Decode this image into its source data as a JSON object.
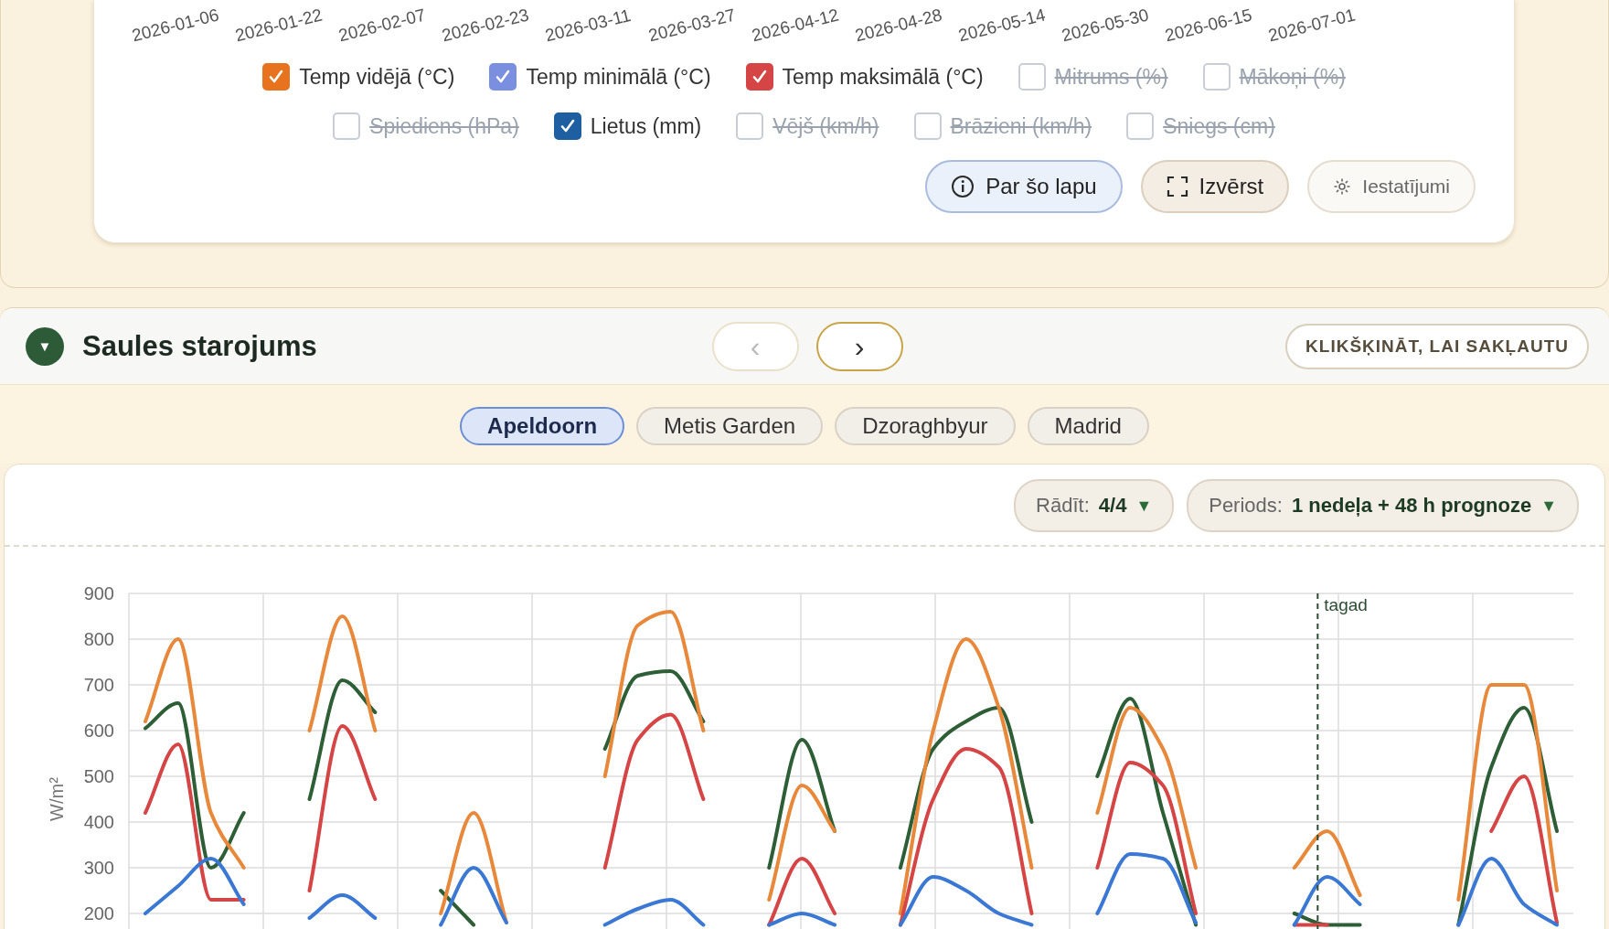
{
  "top_chart": {
    "x_labels": [
      "2026-01-06",
      "2026-01-22",
      "2026-02-07",
      "2026-02-23",
      "2026-03-11",
      "2026-03-27",
      "2026-04-12",
      "2026-04-28",
      "2026-05-14",
      "2026-05-30",
      "2026-06-15",
      "2026-07-01"
    ]
  },
  "legend": [
    {
      "items": [
        {
          "label": "Temp vidējā (°C)",
          "checked": true,
          "color": "#e8731f"
        },
        {
          "label": "Temp minimālā (°C)",
          "checked": true,
          "color": "#7b8fe0"
        },
        {
          "label": "Temp maksimālā (°C)",
          "checked": true,
          "color": "#d64545"
        },
        {
          "label": "Mitrums (%)",
          "checked": false
        },
        {
          "label": "Mākoņi (%)",
          "checked": false
        }
      ]
    },
    {
      "items": [
        {
          "label": "Spiediens (hPa)",
          "checked": false
        },
        {
          "label": "Lietus (mm)",
          "checked": true,
          "color": "#1d5fa0"
        },
        {
          "label": "Vējš (km/h)",
          "checked": false
        },
        {
          "label": "Brāzieni (km/h)",
          "checked": false
        },
        {
          "label": "Sniegs (cm)",
          "checked": false
        }
      ]
    }
  ],
  "actions": [
    {
      "kind": "info",
      "label": "Par šo lapu"
    },
    {
      "kind": "expand",
      "label": "Izvērst"
    },
    {
      "kind": "settings",
      "label": "Iestatījumi"
    }
  ],
  "section": {
    "toggle": "▼",
    "title": "Saules starojums",
    "prev": {
      "glyph": "‹",
      "disabled": true
    },
    "next": {
      "glyph": "›",
      "disabled": false
    },
    "collapse": "KLIKŠĶINĀT, LAI SAKĻAUTU"
  },
  "tabs": [
    {
      "label": "Apeldoorn",
      "selected": true
    },
    {
      "label": "Metis Garden",
      "selected": false
    },
    {
      "label": "Dzoraghbyur",
      "selected": false
    },
    {
      "label": "Madrid",
      "selected": false
    }
  ],
  "filters": [
    {
      "label": "Rādīt:",
      "value": "4/4",
      "caret": "▼"
    },
    {
      "label": "Periods:",
      "value": "1 nedeļa + 48 h prognoze",
      "caret": "▼"
    }
  ],
  "chart_data": {
    "type": "line",
    "ylabel": "W/m²",
    "ylim": [
      160,
      900
    ],
    "yticks": [
      200,
      300,
      400,
      500,
      600,
      700,
      800,
      900
    ],
    "grid": true,
    "annotations": [
      "tagad"
    ],
    "series": [
      {
        "color": "#2d5e36",
        "values": [
          605,
          660,
          300,
          420,
          null,
          450,
          710,
          640,
          null,
          250,
          175,
          null,
          null,
          null,
          560,
          720,
          730,
          620,
          null,
          300,
          580,
          380,
          null,
          300,
          560,
          620,
          650,
          400,
          null,
          500,
          670,
          420,
          175,
          null,
          null,
          200,
          175,
          175,
          null,
          null,
          175,
          520,
          650,
          380
        ]
      },
      {
        "color": "#e8883a",
        "values": [
          620,
          800,
          420,
          300,
          null,
          600,
          850,
          600,
          null,
          200,
          420,
          180,
          null,
          null,
          500,
          830,
          860,
          600,
          null,
          230,
          480,
          380,
          null,
          200,
          600,
          800,
          650,
          300,
          null,
          420,
          650,
          560,
          300,
          null,
          null,
          300,
          380,
          240,
          null,
          null,
          230,
          700,
          700,
          250
        ]
      },
      {
        "color": "#d64545",
        "values": [
          420,
          570,
          230,
          230,
          null,
          250,
          610,
          450,
          null,
          null,
          null,
          null,
          null,
          null,
          300,
          580,
          635,
          450,
          null,
          175,
          320,
          200,
          null,
          175,
          450,
          560,
          520,
          200,
          null,
          300,
          530,
          480,
          200,
          null,
          null,
          175,
          175,
          null,
          null,
          null,
          null,
          380,
          500,
          180
        ]
      },
      {
        "color": "#3a78d4",
        "values": [
          200,
          260,
          320,
          220,
          null,
          190,
          240,
          190,
          null,
          175,
          300,
          180,
          null,
          null,
          175,
          210,
          230,
          175,
          null,
          175,
          200,
          175,
          null,
          175,
          280,
          250,
          200,
          175,
          null,
          200,
          330,
          320,
          180,
          null,
          null,
          175,
          280,
          220,
          null,
          null,
          175,
          320,
          220,
          175
        ]
      }
    ]
  }
}
